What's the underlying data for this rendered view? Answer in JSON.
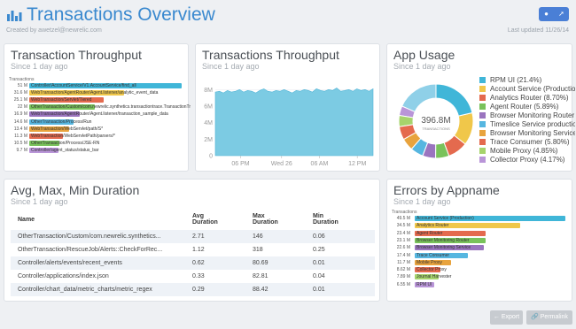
{
  "header": {
    "title": "Transactions Overview",
    "created_by": "Created by awetzel@newrelic.com",
    "last_updated": "Last updated 11/26/14",
    "icons": [
      "bar-chart-icon",
      "bulb-icon",
      "pin-icon"
    ]
  },
  "throughput_list": {
    "title": "Transaction Throughput",
    "subtitle": "Since 1 day ago",
    "caption": "Transactions",
    "rows": [
      {
        "value": "51 M",
        "label": "Controller/AccountService/V1.AccountService/find_all",
        "color": "#40b6d8",
        "fraction": 1.0
      },
      {
        "value": "31.6 M",
        "label": "WebTransaction/AgentRouter/Agent.listener/analytic_event_data",
        "color": "#f0c74a",
        "fraction": 0.62
      },
      {
        "value": "25.1 M",
        "label": "WebTransaction/Servlet/Tiered",
        "color": "#e46a4e",
        "fraction": 0.49
      },
      {
        "value": "22 M",
        "label": "OtherTransaction/Custom/com.newrelic.synthetics.transactiontrace.TransactionTrace",
        "color": "#79c25b",
        "fraction": 0.43
      },
      {
        "value": "16.9 M",
        "label": "WebTransaction/AgentRouter/Agent.listener/transaction_sample_data",
        "color": "#9a74bf",
        "fraction": 0.33
      },
      {
        "value": "14.6 M",
        "label": "OtherTransaction/Process/Run",
        "color": "#56b6e0",
        "fraction": 0.29
      },
      {
        "value": "13.4 M",
        "label": "WebTransaction/WebServlet/path/S*",
        "color": "#e8a33d",
        "fraction": 0.26
      },
      {
        "value": "11.3 M",
        "label": "WebTransaction/WebServletPath/parsers/*",
        "color": "#e46a4e",
        "fraction": 0.22
      },
      {
        "value": "10.5 M",
        "label": "OtherTransaction/Process/JSE-RN",
        "color": "#79c25b",
        "fraction": 0.2
      },
      {
        "value": "9.7 M",
        "label": "Controller/agent_status/status_bar",
        "color": "#b995d8",
        "fraction": 0.19
      }
    ]
  },
  "throughput_chart": {
    "title": "Transactions Throughput",
    "subtitle": "Since 1 day ago"
  },
  "app_usage": {
    "title": "App Usage",
    "subtitle": "Since 1 day ago",
    "donut_value": "396.8M",
    "donut_unit": "TRANSACTIONS",
    "items": [
      {
        "label": "RPM UI (21.4%)",
        "color": "#40b6d8",
        "pct": 21.4
      },
      {
        "label": "Account Service (Production)",
        "color": "#f0c74a",
        "pct": 14.2
      },
      {
        "label": "Analytics Router (8.70%)",
        "color": "#e46a4e",
        "pct": 8.7
      },
      {
        "label": "Agent Router (5.89%)",
        "color": "#79c25b",
        "pct": 5.89
      },
      {
        "label": "Browser Monitoring Router",
        "color": "#9a74bf",
        "pct": 5.7
      },
      {
        "label": "Timeslice Service production",
        "color": "#56b6e0",
        "pct": 5.6
      },
      {
        "label": "Browser Monitoring Service",
        "color": "#e8a33d",
        "pct": 5.4
      },
      {
        "label": "Trace Consumer (5.80%)",
        "color": "#e46a4e",
        "pct": 5.8
      },
      {
        "label": "Mobile Proxy (4.85%)",
        "color": "#a6d36c",
        "pct": 4.85
      },
      {
        "label": "Collector Proxy (4.17%)",
        "color": "#b995d8",
        "pct": 4.17
      },
      {
        "label": "",
        "color": "#8fd0e8",
        "pct": 18.39
      }
    ]
  },
  "duration": {
    "title": "Avg, Max, Min Duration",
    "subtitle": "Since 1 day ago",
    "columns": [
      "Name",
      "Avg Duration",
      "Max Duration",
      "Min Duration"
    ],
    "rows": [
      [
        "OtherTransaction/Custom/com.newrelic.synthetics...",
        "2.71",
        "146",
        "0.06"
      ],
      [
        "OtherTransaction/RescueJob/Alerts::CheckForRec...",
        "1.12",
        "318",
        "0.25"
      ],
      [
        "Controller/alerts/events/recent_events",
        "0.62",
        "80.69",
        "0.01"
      ],
      [
        "Controller/applications/index.json",
        "0.33",
        "82.81",
        "0.04"
      ],
      [
        "Controller/chart_data/metric_charts/metric_regex",
        "0.29",
        "88.42",
        "0.01"
      ]
    ]
  },
  "errors": {
    "title": "Errors by Appname",
    "subtitle": "Since 1 day ago",
    "caption": "Transactions",
    "rows": [
      {
        "value": "49.5 M",
        "label": "Account Service (Production)",
        "color": "#40b6d8",
        "fraction": 1.0
      },
      {
        "value": "34.5 M",
        "label": "Analytics Router",
        "color": "#f0c74a",
        "fraction": 0.7
      },
      {
        "value": "23.4 M",
        "label": "Agent Router",
        "color": "#e46a4e",
        "fraction": 0.47
      },
      {
        "value": "23.1 M",
        "label": "Browser Monitoring Router",
        "color": "#79c25b",
        "fraction": 0.47
      },
      {
        "value": "22.6 M",
        "label": "Browser Monitoring Service",
        "color": "#9a74bf",
        "fraction": 0.46
      },
      {
        "value": "17.4 M",
        "label": "Trace Consumer",
        "color": "#56b6e0",
        "fraction": 0.35
      },
      {
        "value": "11.7 M",
        "label": "Mobile Proxy",
        "color": "#e8a33d",
        "fraction": 0.24
      },
      {
        "value": "8.62 M",
        "label": "Collector Proxy",
        "color": "#e46a4e",
        "fraction": 0.17
      },
      {
        "value": "7.89 M",
        "label": "Journal Harvester",
        "color": "#a6d36c",
        "fraction": 0.16
      },
      {
        "value": "6.55 M",
        "label": "RPM UI",
        "color": "#b995d8",
        "fraction": 0.13
      }
    ]
  },
  "footer": {
    "export_label": "Export",
    "permalink_label": "Permalink"
  },
  "chart_data": {
    "type": "area",
    "x_ticks": [
      "06 PM",
      "Wed 26",
      "06 AM",
      "12 PM"
    ],
    "y_ticks": [
      "8M",
      "6M",
      "4M",
      "2M",
      "0"
    ],
    "ylim": [
      0,
      9
    ],
    "color": "#7ccbe3",
    "values": [
      7.7,
      7.8,
      7.6,
      7.9,
      7.7,
      7.8,
      8.0,
      7.7,
      7.9,
      7.8,
      7.6,
      7.9,
      8.1,
      7.8,
      7.7,
      7.9,
      7.8,
      8.0,
      7.8,
      7.6,
      7.9,
      7.8,
      8.0,
      7.9,
      7.7,
      8.1,
      7.9,
      7.8,
      8.0,
      7.9,
      8.2,
      7.8,
      7.9,
      8.0,
      7.8,
      8.1,
      7.9,
      8.0,
      7.8,
      8.1
    ]
  }
}
